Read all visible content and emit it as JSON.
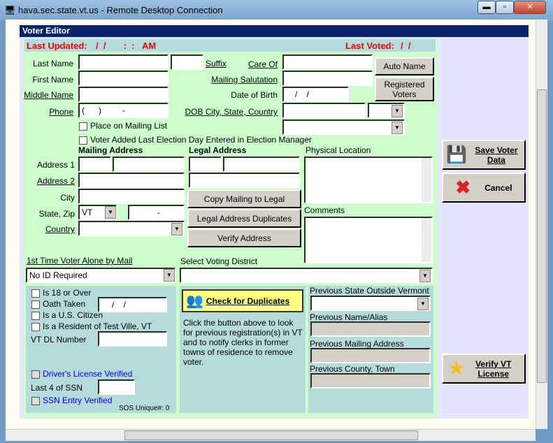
{
  "window": {
    "title": "hava.sec.state.vt.us - Remote Desktop Connection",
    "minimize": "▬",
    "restore": "▫",
    "close": "✕"
  },
  "editor": {
    "title": "Voter Editor",
    "last_updated_label": "Last Updated:",
    "last_updated_value": "/  /       :  :   AM",
    "last_voted_label": "Last Voted:",
    "last_voted_value": "/  /"
  },
  "fields": {
    "last_name": "Last Name",
    "first_name": "First Name",
    "middle_name": "Middle Name",
    "phone": "Phone",
    "phone_value": "(      )         -",
    "suffix": "Suffix",
    "care_of": "Care Of",
    "mailing_salutation": "Mailing Salutation",
    "dob": "Date of Birth",
    "dob_value": "/    /",
    "dob_city": "DOB City, State, Country",
    "place_on_mailing": "Place on Mailing List",
    "voter_added": "Voter Added Last Election Day Entered in Election Manager",
    "auto_name": "Auto Name",
    "registered_voters": "Registered Voters"
  },
  "address": {
    "mailing": "Mailing Address",
    "legal": "Legal Address",
    "physical": "Physical Location",
    "address1": "Address 1",
    "address2": "Address 2",
    "city": "City",
    "state_zip": "State, Zip",
    "state_value": "VT",
    "zip_value": "-",
    "country": "Country",
    "copy": "Copy Mailing to Legal",
    "dups": "Legal Address Duplicates",
    "verify": "Verify Address",
    "comments": "Comments"
  },
  "voting": {
    "first_time": "1st Time Voter Alone by Mail",
    "first_time_value": "No ID Required",
    "district": "Select Voting District"
  },
  "checks": {
    "is18": "Is 18 or Over",
    "oath": "Oath Taken",
    "oath_date": "/    /",
    "citizen": "Is a U.S. Citizen",
    "resident": "Is a Resident of Test Ville, VT",
    "dl": "VT DL Number",
    "dl_verified": "Driver's License Verified",
    "ssn4": "Last 4 of SSN",
    "ssn_verified": "SSN Entry Verified",
    "sos": "SOS Unique#: 0"
  },
  "dup": {
    "button": "Check for Duplicates",
    "help": "Click the button above to look for previous registration(s) in VT and to notify clerks in former towns of residence to remove voter."
  },
  "prev": {
    "state": "Previous State Outside Vermont",
    "name": "Previous Name/Alias",
    "mailing": "Previous Mailing Address",
    "county": "Previous County, Town"
  },
  "side": {
    "save": "Save Voter Data",
    "cancel": "Cancel",
    "verify": "Verify VT License"
  }
}
